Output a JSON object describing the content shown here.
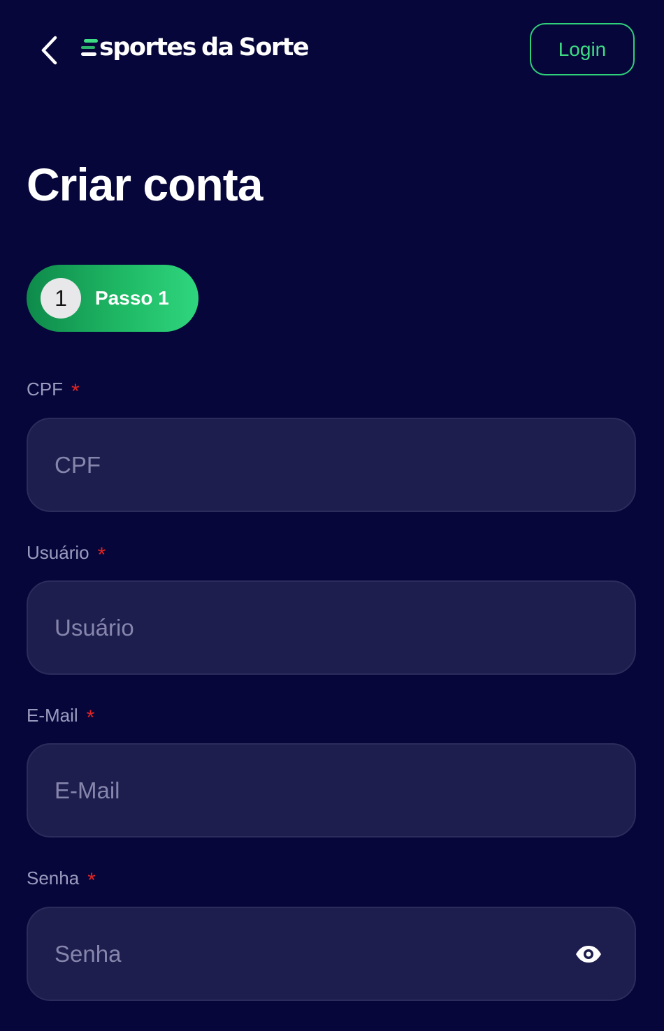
{
  "header": {
    "back_icon": "chevron-left-icon",
    "logo": "Esportes da Sorte",
    "login_label": "Login"
  },
  "title": "Criar conta",
  "step": {
    "number": "1",
    "label": "Passo 1"
  },
  "fields": [
    {
      "label": "CPF",
      "placeholder": "CPF",
      "value": "",
      "required": "*"
    },
    {
      "label": "Usuário",
      "placeholder": "Usuário",
      "value": "",
      "required": "*"
    },
    {
      "label": "E-Mail",
      "placeholder": "E-Mail",
      "value": "",
      "required": "*"
    },
    {
      "label": "Senha",
      "placeholder": "Senha",
      "value": "",
      "required": "*",
      "icon": "eye-icon"
    }
  ],
  "colors": {
    "background": "#06063a",
    "accent": "#2fd07a",
    "field_bg": "#1e1e4e",
    "required": "#e02424"
  }
}
